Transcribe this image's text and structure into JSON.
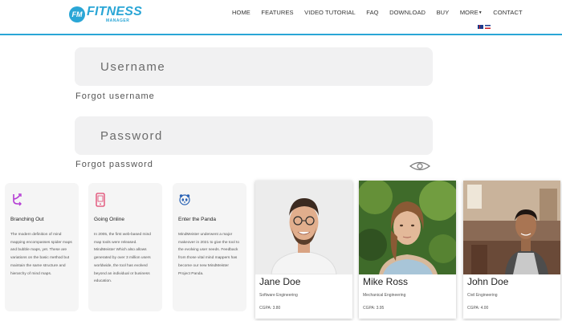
{
  "header": {
    "logo_badge": "FM",
    "logo_main": "FITNESS",
    "logo_sub": "MANAGER",
    "nav": [
      {
        "label": "HOME"
      },
      {
        "label": "FEATURES"
      },
      {
        "label": "VIDEO TUTORIAL"
      },
      {
        "label": "FAQ"
      },
      {
        "label": "DOWNLOAD"
      },
      {
        "label": "BUY"
      },
      {
        "label": "MORE"
      },
      {
        "label": "CONTACT"
      }
    ],
    "accent_color": "#2aa6d6"
  },
  "login": {
    "username_placeholder": "Username",
    "forgot_username": "Forgot username",
    "password_placeholder": "Password",
    "forgot_password": "Forgot password"
  },
  "features": [
    {
      "icon": "branch-icon",
      "title": "Branching Out",
      "text": "The modern definition of mind mapping encompasses spider maps and bubble maps, yet. These are variations on the basic method but maintain the same structure and hierarchy of mind maps."
    },
    {
      "icon": "mobile-icon",
      "title": "Going Online",
      "text": "In 2005, the first web-based mind map tools were released. MindMeister Which also allows generated by over 3 million users worldwide, the tool has evolved beyond an individual or business education."
    },
    {
      "icon": "panda-icon",
      "title": "Enter the Panda",
      "text": "MindMeister underwent a major makeover in 2021 to give the tool to the evolving user needs. Feedback from those vital mind mappers has become our new MindMeister Project Panda."
    }
  ],
  "profiles": [
    {
      "name": "Jane Doe",
      "major": "Software Engineering",
      "gpa": "CGPA: 3.80"
    },
    {
      "name": "Mike Ross",
      "major": "Mechanical Engineering",
      "gpa": "CGPA: 3.95"
    },
    {
      "name": "John Doe",
      "major": "Civil Engineering",
      "gpa": "CGPA: 4.00"
    }
  ]
}
